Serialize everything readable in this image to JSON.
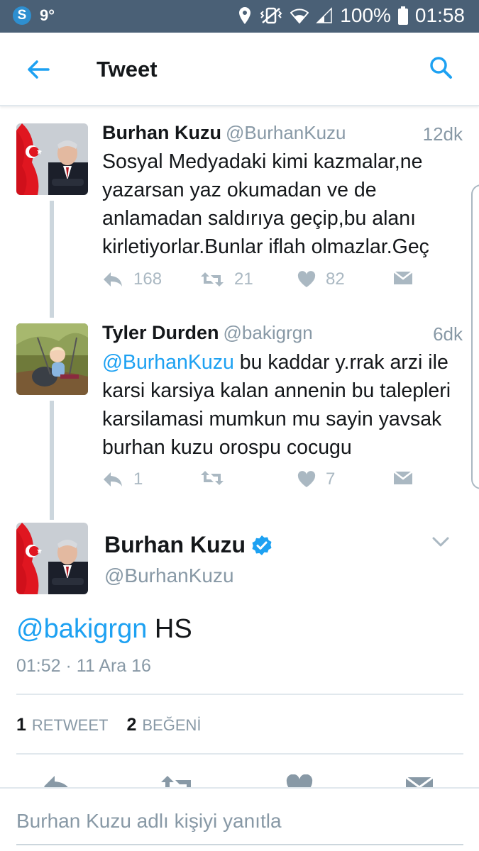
{
  "status_bar": {
    "logo": "S",
    "temperature": "9°",
    "battery": "100%",
    "clock": "01:58"
  },
  "header": {
    "title": "Tweet"
  },
  "thread": [
    {
      "name": "Burhan Kuzu",
      "handle": "@BurhanKuzu",
      "time": "12dk",
      "text": "Sosyal Medyadaki kimi kazmalar,ne yazarsan yaz okumadan ve de anlamadan saldırıya geçip,bu alanı kirletiyorlar.Bunlar iflah olmazlar.Geç",
      "replies": "168",
      "retweets": "21",
      "likes": "82"
    },
    {
      "name": "Tyler Durden",
      "handle": "@bakigrgn",
      "time": "6dk",
      "mention": "@BurhanKuzu",
      "text": " bu kaddar y.rrak arzi ile karsi karsiya kalan annenin bu talepleri karsilamasi mumkun mu sayin yavsak burhan kuzu orospu cocugu",
      "replies": "1",
      "retweets": "",
      "likes": "7"
    }
  ],
  "focused": {
    "name": "Burhan Kuzu",
    "handle": "@BurhanKuzu",
    "mention": "@bakigrgn",
    "text": " HS",
    "timestamp": "01:52 · 11 Ara 16",
    "retweet_count": "1",
    "retweet_label": "RETWEET",
    "like_count": "2",
    "like_label": "BEĞENİ"
  },
  "reply": {
    "placeholder": "Burhan Kuzu adlı kişiyi yanıtla"
  },
  "colors": {
    "accent": "#1da1f2",
    "status_bar": "#4a6076",
    "muted": "#8899a6",
    "icon": "#aab8c2",
    "verified": "#1da1f2"
  }
}
